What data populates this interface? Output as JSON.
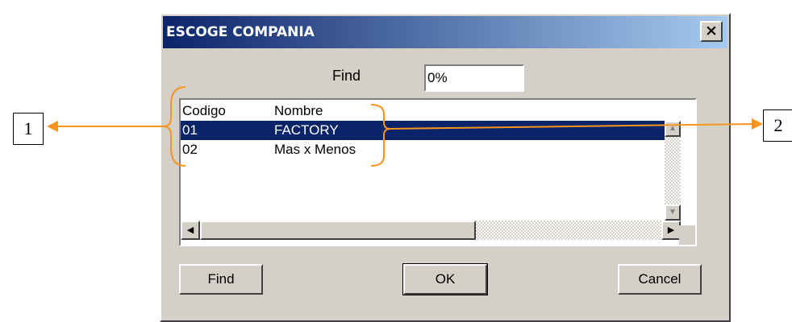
{
  "dialog": {
    "title": "ESCOGE COMPANIA",
    "close_label": "×",
    "find_label": "Find",
    "find_value": "0%"
  },
  "list": {
    "columns": [
      "Codigo",
      "Nombre"
    ],
    "rows": [
      {
        "codigo": "01",
        "nombre": "FACTORY",
        "selected": true
      },
      {
        "codigo": "02",
        "nombre": "Mas x Menos",
        "selected": false
      }
    ]
  },
  "buttons": {
    "find": "Find",
    "ok": "OK",
    "cancel": "Cancel"
  },
  "annotations": {
    "label_1": "1",
    "label_2": "2",
    "accent_color": "#f7941d"
  }
}
